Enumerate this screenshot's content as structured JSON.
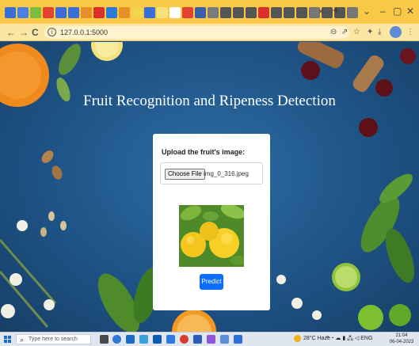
{
  "browser": {
    "tab_icons": [
      {
        "name": "tab-1-icon",
        "color": "#3a6fd8"
      },
      {
        "name": "tab-2-icon",
        "color": "#4a7fe0"
      },
      {
        "name": "tab-3-icon",
        "color": "#7dbb3c"
      },
      {
        "name": "tab-4-icon",
        "color": "#e2452f"
      },
      {
        "name": "tab-5-icon",
        "color": "#3a6fd8"
      },
      {
        "name": "tab-6-icon",
        "color": "#3a6fd8"
      },
      {
        "name": "tab-7-icon",
        "color": "#e88f2a"
      },
      {
        "name": "tab-8-icon",
        "color": "#d8302a"
      },
      {
        "name": "tab-9-icon",
        "color": "#2b7bd8"
      },
      {
        "name": "tab-10-icon",
        "color": "#e88f2a"
      },
      {
        "name": "tab-11-icon",
        "color": "#f0d64a"
      },
      {
        "name": "tab-12-icon",
        "color": "#3a6fd8"
      },
      {
        "name": "tab-13-icon",
        "color": "#f7e27a"
      },
      {
        "name": "tab-14-icon",
        "color": "#ffffff"
      },
      {
        "name": "tab-15-icon",
        "color": "#e2452f"
      },
      {
        "name": "tab-16-icon",
        "color": "#3a5fa8"
      },
      {
        "name": "tab-17-icon",
        "color": "#7a7a7a"
      },
      {
        "name": "tab-18-icon",
        "color": "#555555"
      },
      {
        "name": "tab-19-icon",
        "color": "#555555"
      },
      {
        "name": "tab-20-icon",
        "color": "#555555"
      },
      {
        "name": "tab-21-icon",
        "color": "#d8302a"
      },
      {
        "name": "tab-22-icon",
        "color": "#555555"
      },
      {
        "name": "tab-23-icon",
        "color": "#555555"
      },
      {
        "name": "tab-24-icon",
        "color": "#555555"
      },
      {
        "name": "tab-25-icon",
        "color": "#777777"
      },
      {
        "name": "tab-26-icon",
        "color": "#555555"
      },
      {
        "name": "tab-27-icon",
        "color": "#555555"
      },
      {
        "name": "tab-28-icon",
        "color": "#777777"
      }
    ],
    "tab_close": "×",
    "new_tab": "+",
    "window_controls": {
      "dropdown": "⌄",
      "minimize": "–",
      "maximize": "▢",
      "close": "✕"
    },
    "nav": {
      "back": "←",
      "forward": "→",
      "reload": "C"
    },
    "url": "127.0.0.1:5000",
    "address_icons": {
      "zoom": "⊖",
      "share": "⇗",
      "star": "☆",
      "extensions": "✦",
      "download": "⤓",
      "sidebar": "▯",
      "menu": "⋮"
    }
  },
  "page": {
    "title": "Fruit Recognition and Ripeness Detection",
    "upload_label": "Upload the fruit's image:",
    "choose_file_label": "Choose File",
    "file_name": "img_0_316.jpeg",
    "predict_label": "Predict"
  },
  "taskbar": {
    "search_placeholder": "Type here to search",
    "weather": "28°C Haze",
    "tray": "^ ◔ ☁ ▮ 🖧 ◁ ENG",
    "time": "21:04",
    "date": "06-04-2023"
  },
  "colors": {
    "tab_strip": "#f9c846",
    "address_bar": "#fbe6a4",
    "background": "#1e5386",
    "primary_button": "#0d6efd"
  }
}
